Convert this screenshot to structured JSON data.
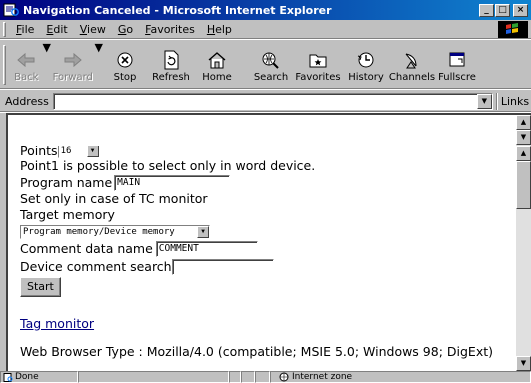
{
  "window": {
    "title": "Navigation Canceled - Microsoft Internet Explorer"
  },
  "menu": [
    "File",
    "Edit",
    "View",
    "Go",
    "Favorites",
    "Help"
  ],
  "toolbar": {
    "back": "Back",
    "forward": "Forward",
    "stop": "Stop",
    "refresh": "Refresh",
    "home": "Home",
    "search": "Search",
    "favorites": "Favorites",
    "history": "History",
    "channels": "Channels",
    "fullscreen": "Fullscre"
  },
  "address": {
    "label": "Address",
    "value": "",
    "links": "Links"
  },
  "form": {
    "points_label": "Points",
    "points_value": "16",
    "note_word_device": "Point1 is possible to select only in word device.",
    "program_name_label": "Program name",
    "program_name_value": "MAIN",
    "tc_monitor_note": "Set only in case of TC monitor",
    "target_memory_label": "Target memory",
    "target_memory_value": "Program memory/Device memory",
    "comment_data_label": "Comment data name",
    "comment_data_value": "COMMENT",
    "device_comment_search_label": "Device comment search",
    "device_comment_search_value": "",
    "start_button": "Start",
    "tag_monitor_link": "Tag monitor",
    "browser_type": "Web Browser Type : Mozilla/4.0 (compatible; MSIE 5.0; Windows 98; DigExt)"
  },
  "status": {
    "done": "Done",
    "zone": "Internet zone"
  },
  "colors": {
    "titlebar": "#000080",
    "face": "#c0c0c0",
    "link": "#000080"
  }
}
